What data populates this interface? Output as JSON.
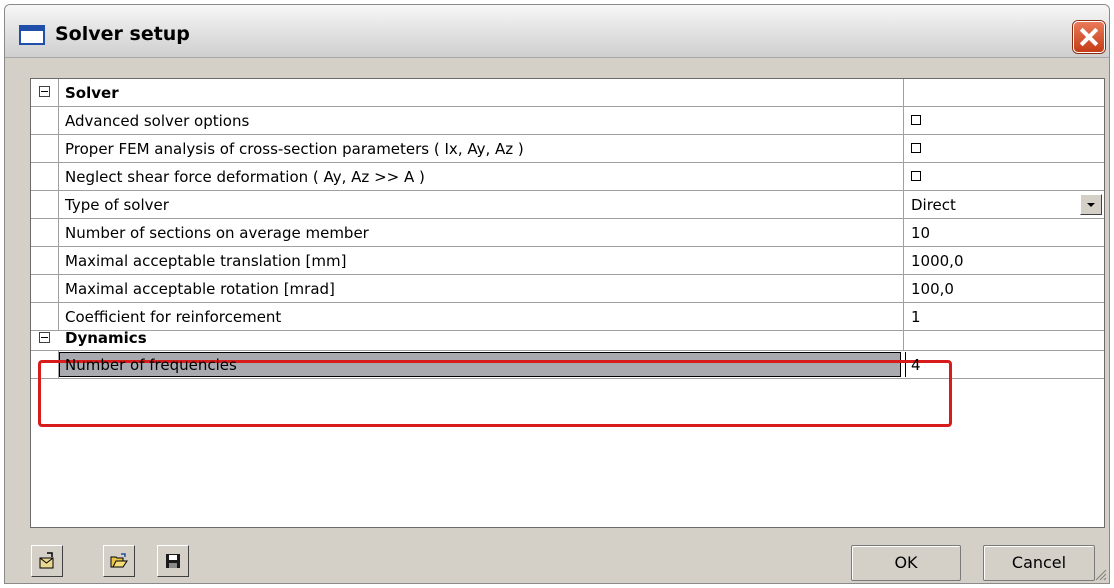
{
  "window": {
    "title": "Solver setup"
  },
  "groups": {
    "solver": {
      "label": "Solver",
      "rows": [
        {
          "label": "Advanced solver options",
          "type": "checkbox",
          "checked": false
        },
        {
          "label": "Proper FEM analysis of cross-section parameters ( Ix, Ay, Az )",
          "type": "checkbox",
          "checked": false
        },
        {
          "label": "Neglect shear force deformation ( Ay, Az >> A )",
          "type": "checkbox",
          "checked": false
        },
        {
          "label": "Type of solver",
          "type": "select",
          "value": "Direct"
        },
        {
          "label": "Number of sections on average member",
          "type": "text",
          "value": "10"
        },
        {
          "label": "Maximal acceptable translation [mm]",
          "type": "text",
          "value": "1000,0"
        },
        {
          "label": "Maximal acceptable rotation [mrad]",
          "type": "text",
          "value": "100,0"
        },
        {
          "label": "Coefficient for reinforcement",
          "type": "text",
          "value": "1"
        }
      ]
    },
    "dynamics": {
      "label": "Dynamics",
      "rows": [
        {
          "label": "Number of frequencies",
          "type": "text",
          "value": "4",
          "selected": true
        }
      ]
    }
  },
  "buttons": {
    "ok": "OK",
    "cancel": "Cancel"
  },
  "toolbar": {
    "icons": [
      "export-icon",
      "open-folder-icon",
      "save-icon"
    ]
  },
  "colors": {
    "highlight": "#d81c1c",
    "selection": "#a9a9b0",
    "window_bg": "#d4d0c8"
  }
}
